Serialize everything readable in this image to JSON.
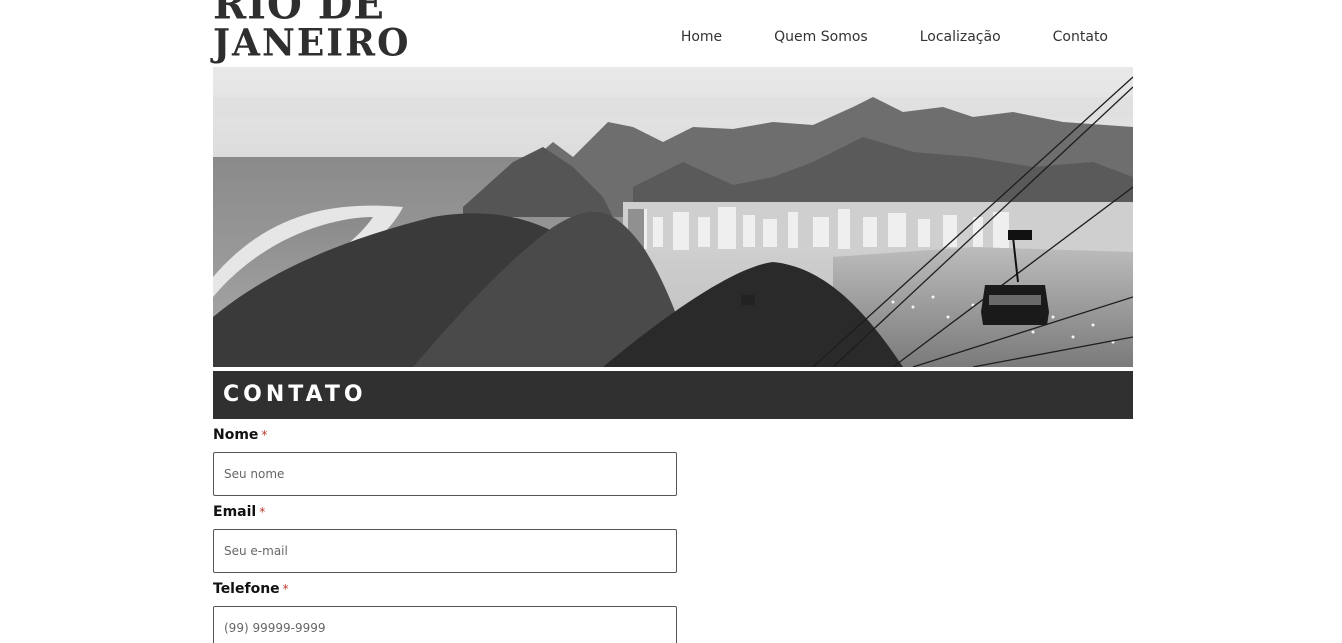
{
  "header": {
    "logo_line1": "RIO DE",
    "logo_line2": "JANEIRO"
  },
  "nav": {
    "items": [
      {
        "label": "Home"
      },
      {
        "label": "Quem Somos"
      },
      {
        "label": "Localização"
      },
      {
        "label": "Contato"
      }
    ]
  },
  "section": {
    "title": "CONTATO"
  },
  "form": {
    "required_mark": "*",
    "fields": [
      {
        "label": "Nome",
        "placeholder": "Seu nome"
      },
      {
        "label": "Email",
        "placeholder": "Seu e-mail"
      },
      {
        "label": "Telefone",
        "placeholder": "(99) 99999-9999"
      }
    ]
  }
}
